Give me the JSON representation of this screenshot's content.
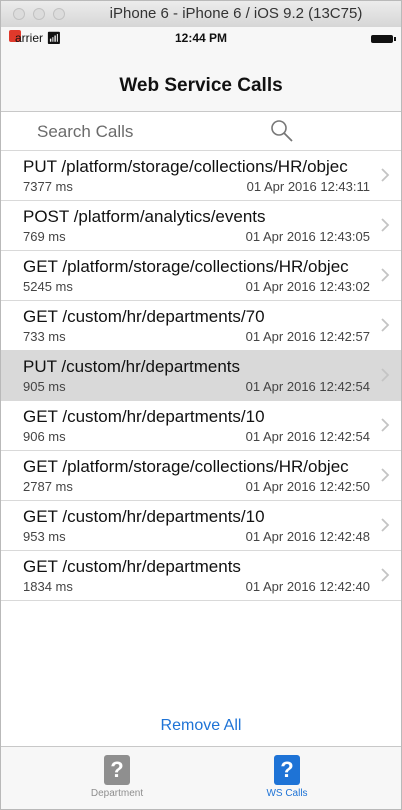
{
  "simulator": {
    "title": "iPhone 6 - iPhone 6 / iOS 9.2 (13C75)"
  },
  "status_bar": {
    "carrier": "arrier",
    "time": "12:44 PM"
  },
  "nav": {
    "title": "Web Service Calls"
  },
  "search": {
    "placeholder": "Search Calls"
  },
  "calls": [
    {
      "title": "PUT /platform/storage/collections/HR/objec",
      "duration": "7377 ms",
      "date": "01 Apr 2016 12:43:11",
      "selected": false
    },
    {
      "title": "POST /platform/analytics/events",
      "duration": "769 ms",
      "date": "01 Apr 2016 12:43:05",
      "selected": false
    },
    {
      "title": "GET /platform/storage/collections/HR/objec",
      "duration": "5245 ms",
      "date": "01 Apr 2016 12:43:02",
      "selected": false
    },
    {
      "title": "GET /custom/hr/departments/70",
      "duration": "733 ms",
      "date": "01 Apr 2016 12:42:57",
      "selected": false
    },
    {
      "title": "PUT /custom/hr/departments",
      "duration": "905 ms",
      "date": "01 Apr 2016 12:42:54",
      "selected": true
    },
    {
      "title": "GET /custom/hr/departments/10",
      "duration": "906 ms",
      "date": "01 Apr 2016 12:42:54",
      "selected": false
    },
    {
      "title": "GET /platform/storage/collections/HR/objec",
      "duration": "2787 ms",
      "date": "01 Apr 2016 12:42:50",
      "selected": false
    },
    {
      "title": "GET /custom/hr/departments/10",
      "duration": "953 ms",
      "date": "01 Apr 2016 12:42:48",
      "selected": false
    },
    {
      "title": "GET /custom/hr/departments",
      "duration": "1834 ms",
      "date": "01 Apr 2016 12:42:40",
      "selected": false
    }
  ],
  "actions": {
    "remove_all": "Remove All"
  },
  "tabs": [
    {
      "label": "Department",
      "icon": "?",
      "active": false
    },
    {
      "label": "WS Calls",
      "icon": "?",
      "active": true
    }
  ],
  "colors": {
    "accent": "#1e73d6",
    "selected_row": "#d9d9d9",
    "inactive_tab": "#8f8f8f"
  }
}
